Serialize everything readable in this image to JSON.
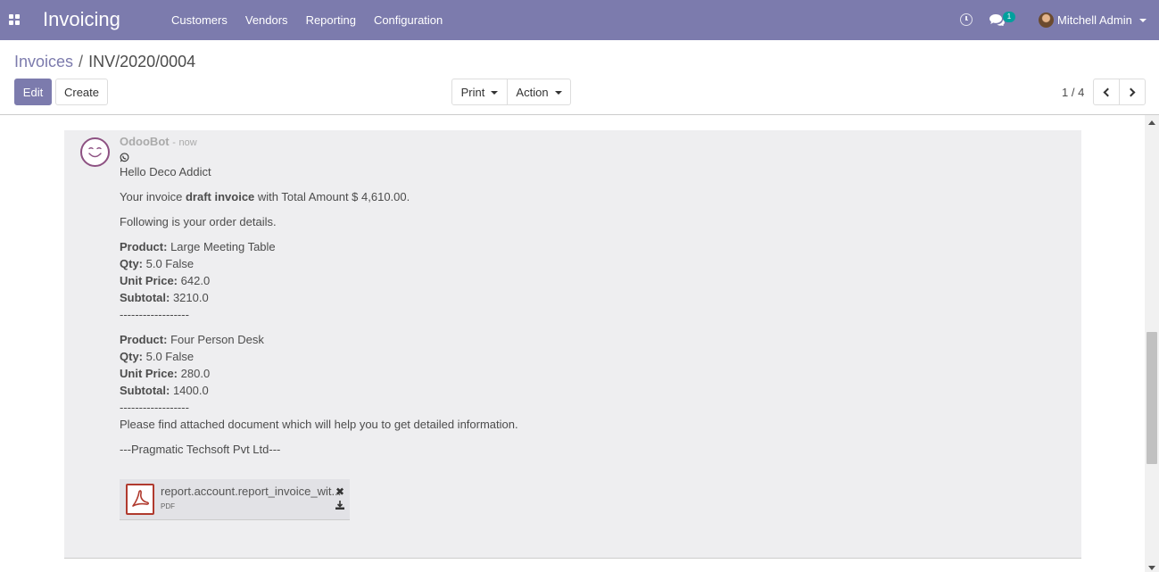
{
  "navbar": {
    "brand": "Invoicing",
    "menu": [
      "Customers",
      "Vendors",
      "Reporting",
      "Configuration"
    ],
    "chat_badge": "1",
    "user_name": "Mitchell Admin",
    "color": "#7c7bad"
  },
  "breadcrumb": {
    "parent": "Invoices",
    "separator": "/",
    "current": "INV/2020/0004"
  },
  "buttons": {
    "edit": "Edit",
    "create": "Create",
    "print": "Print",
    "action": "Action"
  },
  "pager": {
    "value": "1 / 4"
  },
  "message": {
    "author": "OdooBot",
    "separator": "-",
    "date": "now",
    "greeting": "Hello Deco Addict",
    "invoice_prefix": "Your invoice",
    "invoice_name": "draft invoice",
    "invoice_suffix": "with Total Amount $ 4,610.00.",
    "details_intro": "Following is your order details.",
    "labels": {
      "product": "Product:",
      "qty": "Qty:",
      "unit_price": "Unit Price:",
      "subtotal": "Subtotal:"
    },
    "products": [
      {
        "product": "Large Meeting Table",
        "qty": "5.0 False",
        "unit_price": "642.0",
        "subtotal": "3210.0"
      },
      {
        "product": "Four Person Desk",
        "qty": "5.0 False",
        "unit_price": "280.0",
        "subtotal": "1400.0"
      }
    ],
    "divider": "------------------",
    "closing": "Please find attached document which will help you to get detailed information.",
    "signature": "---Pragmatic Techsoft Pvt Ltd---"
  },
  "attachment": {
    "name": "report.account.report_invoice_wit...",
    "ext": "PDF"
  },
  "icons": {
    "apps": "apps-grid-icon",
    "clock": "clock-icon",
    "chat": "chat-icon",
    "whatsapp": "whatsapp-icon",
    "pdf": "pdf-icon",
    "close": "close-icon",
    "download": "download-icon"
  }
}
